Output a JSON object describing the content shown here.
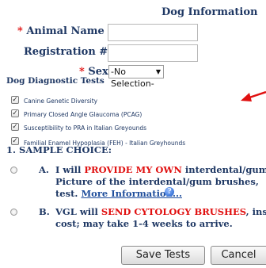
{
  "section_title": "Dog Information",
  "fields": {
    "animal_name": {
      "label": "Animal Name",
      "value": ""
    },
    "registration": {
      "label": "Registration #",
      "value": ""
    },
    "sex": {
      "label": "Sex",
      "selected": "-No Selection-"
    }
  },
  "required_marker": "*",
  "diagnostic_tests": {
    "heading": "Dog Diagnostic Tests",
    "items": [
      {
        "label": "Canine Genetic Diversity",
        "checked": true
      },
      {
        "label": "Primary Closed Angle Glaucoma (PCAG)",
        "checked": true
      },
      {
        "label": "Susceptibility to PRA in Italian Greyounds",
        "checked": true
      },
      {
        "label": "Familial Enamel Hypoplasia (FEH) - Italian Greyhounds",
        "checked": true
      }
    ]
  },
  "sample_choice": {
    "heading": "1. SAMPLE CHOICE:",
    "options": [
      {
        "letter": "A.",
        "line1_pre": "I will ",
        "line1_red": "PROVIDE MY OWN",
        "line1_post": " interdental/gum",
        "line2": "Picture of the interdental/gum brushes,",
        "line3_pre": "test. ",
        "line3_link": "More Information...",
        "info_icon": "info-icon"
      },
      {
        "letter": "B.",
        "line1_pre": "VGL will ",
        "line1_red": "SEND CYTOLOGY BRUSHES",
        "line1_post": ", instr",
        "line2": "cost; may take 1-4 weeks to arrive."
      }
    ]
  },
  "buttons": {
    "save": "Save Tests",
    "cancel": "Cancel"
  },
  "annotation": {
    "icon": "red-arrow-icon",
    "color": "#e01010"
  },
  "colors": {
    "label_text": "#1f3864",
    "required": "#e01010",
    "link": "#1f4e9c"
  }
}
